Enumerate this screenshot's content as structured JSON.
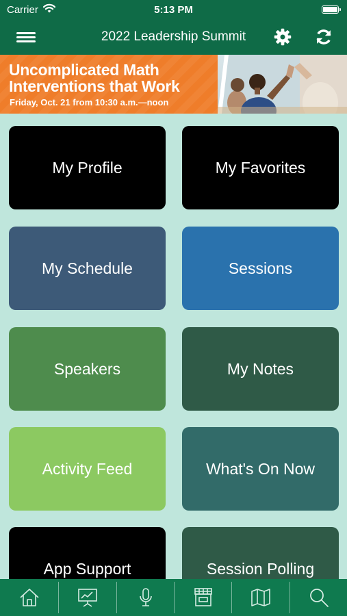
{
  "status_bar": {
    "carrier": "Carrier",
    "time": "5:13 PM"
  },
  "header": {
    "title": "2022 Leadership Summit",
    "icons": [
      "menu-icon",
      "gear-icon",
      "refresh-icon"
    ]
  },
  "banner": {
    "line1": "Uncomplicated Math",
    "line2": "Interventions that Work",
    "line3": "Friday, Oct. 21 from 10:30 a.m.—noon",
    "color": "#ef7d2a"
  },
  "tiles": [
    {
      "label": "My Profile",
      "color": "#000000"
    },
    {
      "label": "My Favorites",
      "color": "#000000"
    },
    {
      "label": "My Schedule",
      "color": "#3d5a78"
    },
    {
      "label": "Sessions",
      "color": "#2a72ad"
    },
    {
      "label": "Speakers",
      "color": "#4e8c4d"
    },
    {
      "label": "My Notes",
      "color": "#2f5a47"
    },
    {
      "label": "Activity Feed",
      "color": "#8cc961"
    },
    {
      "label": "What's On Now",
      "color": "#326b69"
    },
    {
      "label": "App Support",
      "color": "#000000"
    },
    {
      "label": "Session Polling",
      "color": "#2f5a47"
    }
  ],
  "tab_bar": {
    "icons": [
      "home-icon",
      "presentation-icon",
      "microphone-icon",
      "exhibitor-booth-icon",
      "map-icon",
      "search-icon"
    ]
  },
  "colors": {
    "header": "#0f6b47",
    "tab_bar": "#0f7a4f",
    "background": "#bfe6dc"
  }
}
